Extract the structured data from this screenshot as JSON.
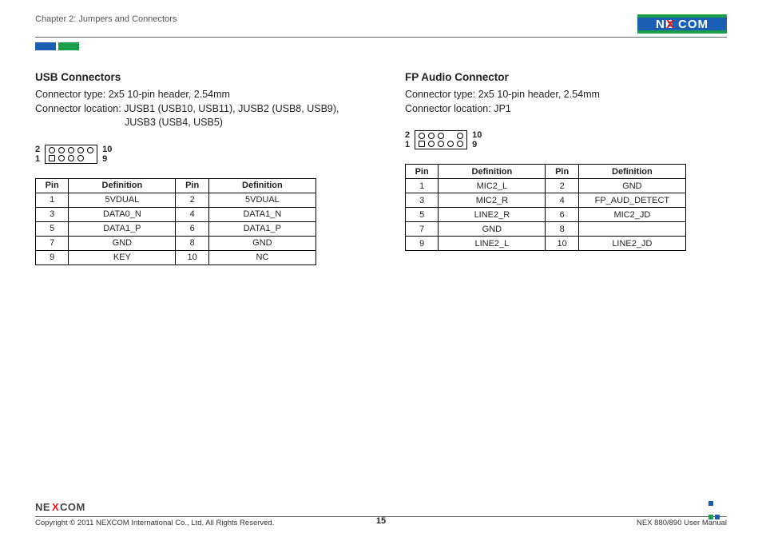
{
  "header": {
    "chapter": "Chapter 2: Jumpers and Connectors",
    "brand": "NEXCOM"
  },
  "left": {
    "title": "USB Connectors",
    "conn_type_label": "Connector type:",
    "conn_type_value": "2x5 10-pin header, 2.54mm",
    "conn_loc_label": "Connector location:",
    "conn_loc_value_l1": "JUSB1 (USB10, USB11), JUSB2 (USB8, USB9),",
    "conn_loc_value_l2": "JUSB3 (USB4, USB5)",
    "pin_legend": {
      "tl": "2",
      "bl": "1",
      "tr": "10",
      "br": "9"
    },
    "table": {
      "h_pin": "Pin",
      "h_def": "Definition",
      "rows": [
        {
          "p1": "1",
          "d1": "5VDUAL",
          "p2": "2",
          "d2": "5VDUAL"
        },
        {
          "p1": "3",
          "d1": "DATA0_N",
          "p2": "4",
          "d2": "DATA1_N"
        },
        {
          "p1": "5",
          "d1": "DATA1_P",
          "p2": "6",
          "d2": "DATA1_P"
        },
        {
          "p1": "7",
          "d1": "GND",
          "p2": "8",
          "d2": "GND"
        },
        {
          "p1": "9",
          "d1": "KEY",
          "p2": "10",
          "d2": "NC"
        }
      ]
    }
  },
  "right": {
    "title": "FP Audio Connector",
    "conn_type_label": "Connector type:",
    "conn_type_value": "2x5 10-pin header, 2.54mm",
    "conn_loc_label": "Connector location:",
    "conn_loc_value": "JP1",
    "pin_legend": {
      "tl": "2",
      "bl": "1",
      "tr": "10",
      "br": "9"
    },
    "table": {
      "h_pin": "Pin",
      "h_def": "Definition",
      "rows": [
        {
          "p1": "1",
          "d1": "MIC2_L",
          "p2": "2",
          "d2": "GND"
        },
        {
          "p1": "3",
          "d1": "MIC2_R",
          "p2": "4",
          "d2": "FP_AUD_DETECT"
        },
        {
          "p1": "5",
          "d1": "LINE2_R",
          "p2": "6",
          "d2": "MIC2_JD"
        },
        {
          "p1": "7",
          "d1": "GND",
          "p2": "8",
          "d2": ""
        },
        {
          "p1": "9",
          "d1": "LINE2_L",
          "p2": "10",
          "d2": "LINE2_JD"
        }
      ]
    }
  },
  "footer": {
    "copyright": "Copyright © 2011 NEXCOM International Co., Ltd. All Rights Reserved.",
    "page": "15",
    "manual": "NEX 880/890 User Manual"
  }
}
